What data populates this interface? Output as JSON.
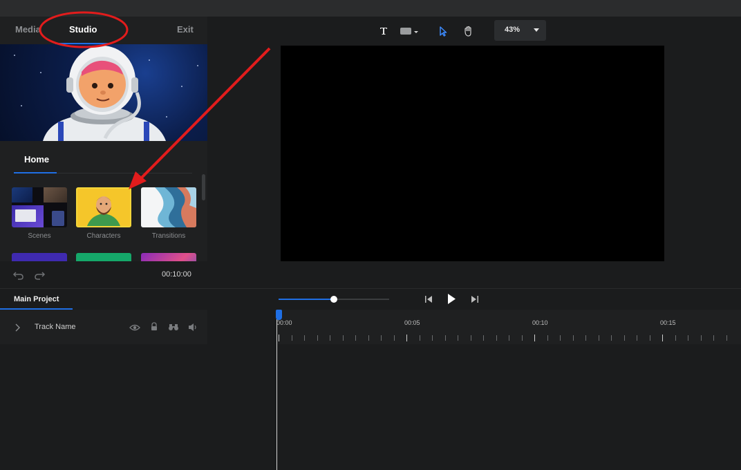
{
  "nav": {
    "media": "Media",
    "studio": "Studio",
    "exit": "Exit"
  },
  "library": {
    "home_tab": "Home",
    "tiles": [
      {
        "label": "Scenes"
      },
      {
        "label": "Characters"
      },
      {
        "label": "Transitions"
      }
    ]
  },
  "toolbar": {
    "icons": [
      "text-icon",
      "shape-icon",
      "select-cursor-icon",
      "hand-icon"
    ],
    "zoom_value": "43%"
  },
  "controls": {
    "time": "00:10:00"
  },
  "timeline": {
    "project_tab": "Main Project",
    "track_name": "Track Name",
    "ruler_labels": [
      "00:00",
      "00:05",
      "00:10",
      "00:15"
    ],
    "scrub_fraction": 0.5
  },
  "colors": {
    "accent": "#1f6fe5",
    "annotation": "#e21c1c",
    "highlight": "#f3d63a"
  }
}
